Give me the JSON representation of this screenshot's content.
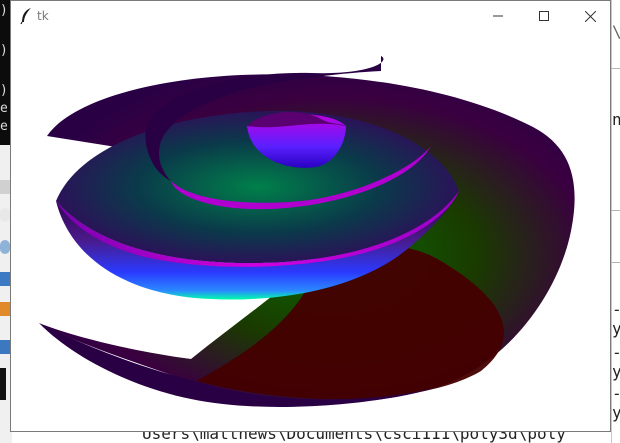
{
  "window": {
    "title": "tk"
  },
  "background": {
    "terminal_glyphs": [
      ")",
      ")",
      ")",
      "e",
      "e"
    ],
    "right_fragments": [
      "\\",
      "n",
      "-y",
      "-y",
      "-y"
    ],
    "bottom_text": "Users\\matthews\\Documents\\csci111\\poly3d\\poly"
  },
  "canvas": {
    "content": "3D spiral surface render",
    "colors": {
      "dark_purple": "#2a0045",
      "magenta": "#c200d8",
      "blue": "#2a1bff",
      "green": "#0a6a00",
      "maroon": "#440000",
      "cyan": "#00ffaa"
    }
  }
}
